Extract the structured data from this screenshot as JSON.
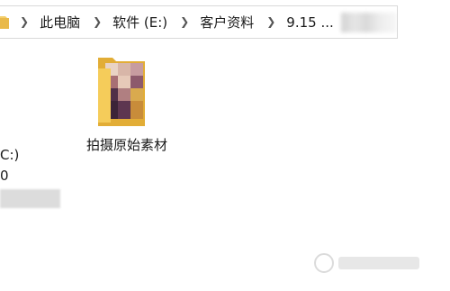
{
  "address_bar": {
    "crumbs": [
      "此电脑",
      "软件 (E:)",
      "客户资料",
      "9.15 ..."
    ],
    "separator": ">"
  },
  "nav_pane": {
    "drive_label": "C:)",
    "drive_sub": "0"
  },
  "content": {
    "items": [
      {
        "label": "拍摄原始素材",
        "icon": "folder-icon-with-image"
      }
    ]
  },
  "colors": {
    "folder_yellow": "#f5cc5a",
    "folder_dark": "#e2ad36",
    "border": "#d9d9d9"
  }
}
